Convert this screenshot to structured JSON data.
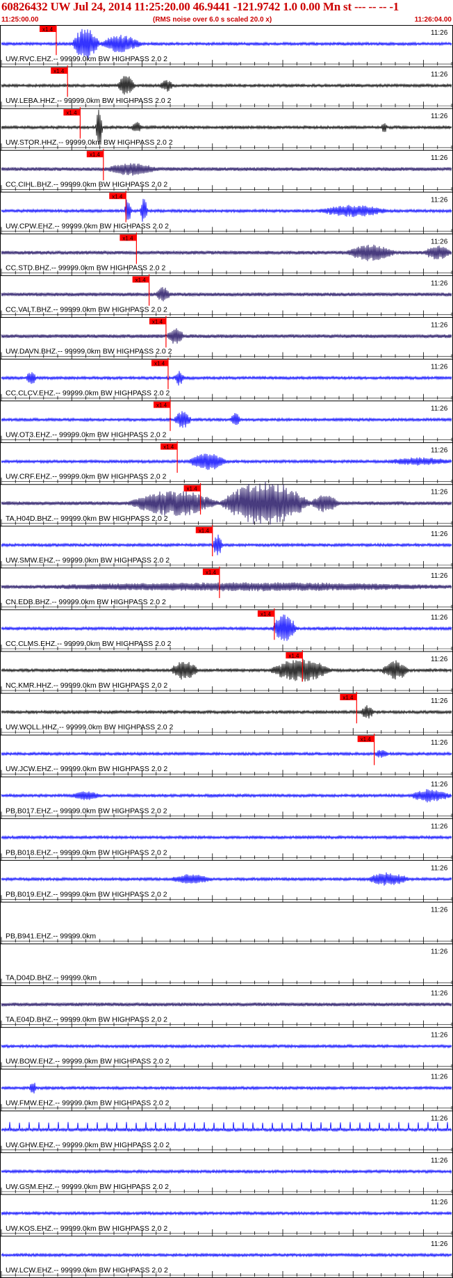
{
  "header": {
    "title": "60826432 UW Jul 24, 2014 11:25:20.00   46.9441 -121.9742  1.0 0.00 Mn st --- -- --  -1",
    "start_time": "11:25:00.00",
    "note": "(RMS noise over 6.0 s scaled 20.0 x)",
    "end_time": "11:26:04.00"
  },
  "chart_data": {
    "type": "seismogram",
    "time_start": "11:25:00.00",
    "time_end": "11:26:04.00",
    "tick_label": "11:26",
    "pick_label": "x1.4",
    "colors": {
      "black": "#000000",
      "blue": "#0000ff",
      "navy": "#1a0a5e",
      "pick": "#ff0000"
    },
    "traces": [
      {
        "label": "UW.RVC.EHZ.--  99999.0km BW  HIGHPASS  2.0  2",
        "color": "blue",
        "pick_s": 7.8,
        "bursts": [
          [
            10,
            14,
            1.6
          ],
          [
            14,
            20,
            0.8
          ]
        ]
      },
      {
        "label": "UW.LEBA.HHZ.-- 99999.0km BW  HIGHPASS  2.0  2",
        "color": "black",
        "pick_s": 9.4,
        "bursts": [
          [
            16.5,
            19,
            1.0
          ],
          [
            22.5,
            24.5,
            0.5
          ]
        ]
      },
      {
        "label": "UW.STOR.HHZ.-- 99999.0km BW  HIGHPASS  2.0  2",
        "color": "black",
        "pick_s": 11.2,
        "bursts": [
          [
            13.4,
            14.4,
            2.0
          ],
          [
            18.5,
            20,
            0.5
          ],
          [
            54,
            54.8,
            0.5
          ]
        ]
      },
      {
        "label": "CC.CIHL.BHZ.-- 99999.0km BW  HIGHPASS  2.0  2",
        "color": "navy",
        "pick_s": 14.5,
        "bursts": [
          [
            15,
            22,
            0.5
          ]
        ]
      },
      {
        "label": "UW.CPW.EHZ.--  99999.0km BW  HIGHPASS  2.0  2",
        "color": "blue",
        "pick_s": 17.7,
        "bursts": [
          [
            17.5,
            18.5,
            1.4
          ],
          [
            19.7,
            20.8,
            1.3
          ],
          [
            45,
            55,
            0.5
          ]
        ]
      },
      {
        "label": "CC.STD.BHZ.--  99999.0km BW  HIGHPASS  2.0  2",
        "color": "navy",
        "pick_s": 19.2,
        "bursts": [
          [
            49,
            56,
            0.7
          ],
          [
            60,
            64,
            0.6
          ]
        ]
      },
      {
        "label": "CC.VALT.BHZ.-- 99999.0km BW  HIGHPASS  2.0  2",
        "color": "navy",
        "pick_s": 21.0,
        "bursts": [
          [
            22,
            24,
            0.7
          ]
        ]
      },
      {
        "label": "UW.DAVN.BHZ.-- 99999.0km BW  HIGHPASS  2.0  2",
        "color": "navy",
        "pick_s": 23.4,
        "bursts": [
          [
            23.5,
            26,
            0.7
          ]
        ]
      },
      {
        "label": "CC.CLCV.EHZ.-- 99999.0km BW  HIGHPASS  2.0  2",
        "color": "blue",
        "pick_s": 23.7,
        "bursts": [
          [
            3.5,
            5,
            0.6
          ],
          [
            24.6,
            26,
            0.7
          ]
        ]
      },
      {
        "label": "UW.OT3.EHZ.--  99999.0km BW  HIGHPASS  2.0  2",
        "color": "blue",
        "pick_s": 24.0,
        "bursts": [
          [
            24.5,
            27,
            0.8
          ],
          [
            32.5,
            34,
            0.6
          ]
        ]
      },
      {
        "label": "UW.CRF.EHZ.--  99999.0km BW  HIGHPASS  2.0  2",
        "color": "blue",
        "pick_s": 25.0,
        "bursts": [
          [
            26.5,
            32,
            0.8
          ],
          [
            55,
            64,
            0.3
          ]
        ]
      },
      {
        "label": "TA.H04D.BHZ.-- 99999.0km BW  HIGHPASS  2.0  2",
        "color": "navy",
        "pick_s": 28.3,
        "bursts": [
          [
            18,
            31,
            1.2
          ],
          [
            31,
            44,
            2.2
          ],
          [
            44,
            48,
            0.8
          ]
        ]
      },
      {
        "label": "UW.SMW.EHZ.--  99999.0km BW  HIGHPASS  2.0  2",
        "color": "blue",
        "pick_s": 30.0,
        "bursts": [
          [
            30,
            31.5,
            1.0
          ]
        ]
      },
      {
        "label": "CN.EDB.BHZ.--  99999.0km BW  HIGHPASS  2.0  2",
        "color": "navy",
        "pick_s": 31.0,
        "bursts": [
          [
            5,
            64,
            0.3
          ]
        ]
      },
      {
        "label": "CC.CLMS.EHZ.-- 99999.0km BW  HIGHPASS  2.0  2",
        "color": "blue",
        "pick_s": 38.8,
        "bursts": [
          [
            38.5,
            42,
            1.5
          ]
        ]
      },
      {
        "label": "NC.KMR.HHZ.--  99999.0km BW  HIGHPASS  2.0  2",
        "color": "black",
        "pick_s": 42.8,
        "bursts": [
          [
            24,
            28,
            0.9
          ],
          [
            38,
            47,
            1.1
          ],
          [
            54,
            58,
            0.9
          ]
        ]
      },
      {
        "label": "UW.WOLL.HHZ.-- 99999.0km BW  HIGHPASS  2.0  2",
        "color": "black",
        "pick_s": 50.5,
        "bursts": [
          [
            51,
            53,
            0.6
          ]
        ]
      },
      {
        "label": "UW.JCW.EHZ.--  99999.0km BW  HIGHPASS  2.0  2",
        "color": "blue",
        "pick_s": 53.0,
        "bursts": [
          [
            53,
            55,
            0.3
          ]
        ]
      },
      {
        "label": "PB.B017.EHZ.-- 99999.0km BW  HIGHPASS  2.0  2",
        "color": "blue",
        "bursts": [
          [
            10,
            14,
            0.4
          ],
          [
            58,
            64,
            0.6
          ]
        ]
      },
      {
        "label": "PB.B018.EHZ.-- 99999.0km BW  HIGHPASS  2.0  2",
        "color": "blue",
        "bursts": []
      },
      {
        "label": "PB.B019.EHZ.-- 99999.0km BW  HIGHPASS  2.0  2",
        "color": "blue",
        "bursts": [
          [
            24,
            30,
            0.4
          ],
          [
            52,
            58,
            0.6
          ]
        ]
      },
      {
        "label": "PB.B941.EHZ.-- 99999.0km",
        "color": "none",
        "bursts": []
      },
      {
        "label": "TA.D04D.BHZ.-- 99999.0km",
        "color": "none",
        "bursts": []
      },
      {
        "label": "TA.E04D.BHZ.-- 99999.0km BW  HIGHPASS  2.0  2",
        "color": "navy",
        "bursts": []
      },
      {
        "label": "UW.BOW.EHZ.--  99999.0km BW  HIGHPASS  2.0  2",
        "color": "blue",
        "bursts": []
      },
      {
        "label": "UW.FMW.EHZ.--  99999.0km BW  HIGHPASS  2.0  2",
        "color": "blue",
        "bursts": [
          [
            4,
            5,
            0.6
          ]
        ]
      },
      {
        "label": "UW.GHW.EHZ.--  99999.0km BW  HIGHPASS  2.0  2",
        "color": "blue",
        "bursts": [],
        "spikes": true
      },
      {
        "label": "UW.GSM.EHZ.--  99999.0km BW  HIGHPASS  2.0  2",
        "color": "blue",
        "bursts": []
      },
      {
        "label": "UW.KOS.EHZ.--  99999.0km BW  HIGHPASS  2.0  2",
        "color": "blue",
        "bursts": []
      },
      {
        "label": "UW.LCW.EHZ.--  99999.0km BW  HIGHPASS  2.0  2",
        "color": "blue",
        "bursts": []
      }
    ]
  }
}
